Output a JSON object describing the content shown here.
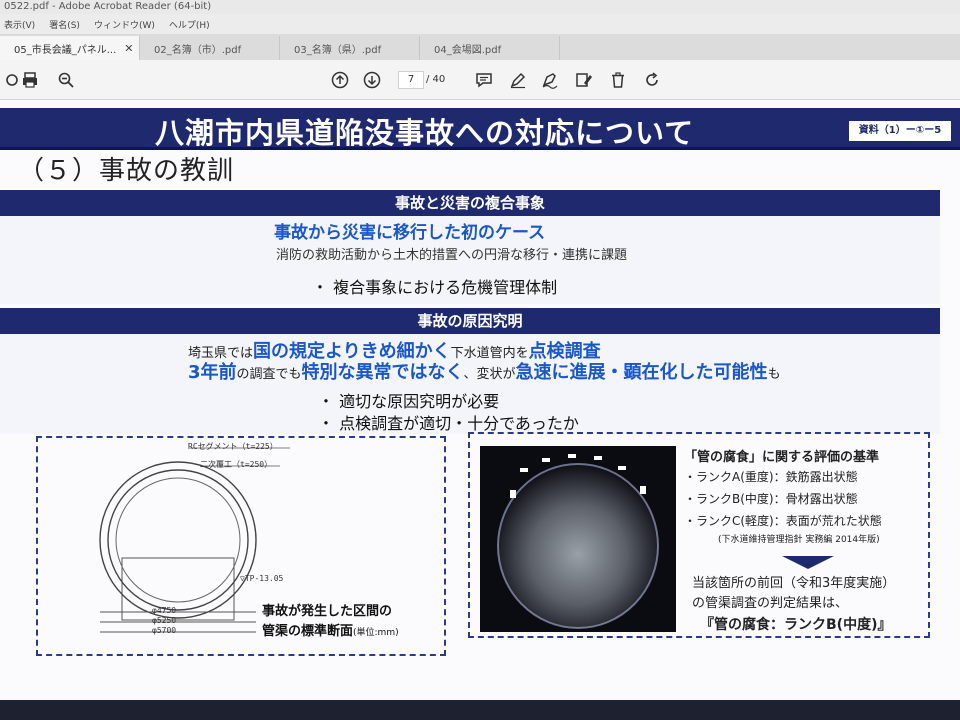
{
  "window": {
    "title": "0522.pdf - Adobe Acrobat Reader (64-bit)"
  },
  "menu": [
    "表示(V)",
    "署名(S)",
    "ウィンドウ(W)",
    "ヘルプ(H)"
  ],
  "tabs": [
    {
      "label": "05_市長会議_パネル...",
      "active": true
    },
    {
      "label": "02_名簿（市）.pdf",
      "active": false
    },
    {
      "label": "03_名簿（県）.pdf",
      "active": false
    },
    {
      "label": "04_会場図.pdf",
      "active": false
    }
  ],
  "toolbar": {
    "page_current": "7",
    "page_total": "/ 40"
  },
  "slide": {
    "title": "八潮市内県道陥没事故への対応について",
    "ref": "資料（1）ー①ー5",
    "section": "（５）事故の教訓",
    "block1": {
      "header": "事故と災害の複合事象",
      "line_a": "事故から災害に移行した初のケース",
      "line_b": "消防の救助活動から土木的措置への円滑な移行・連携に課題",
      "bullet": "・ 複合事象における危機管理体制"
    },
    "block2": {
      "header": "事故の原因究明",
      "line1_pre": "埼玉県では",
      "line1_b1": "国の規定よりきめ細かく",
      "line1_mid": "下水道管内を",
      "line1_b2": "点検調査",
      "line2_b1": "3年前",
      "line2_mid": "の調査でも",
      "line2_b2": "特別な異常ではなく",
      "line2_mid2": "、変状が",
      "line2_b3": "急速に進展・顕在化した可能性",
      "line2_post": "も",
      "bullet1": "・ 適切な原因究明が必要",
      "bullet2": "・ 点検調査が適切・十分であったか"
    },
    "diagram": {
      "lbl1": "RCセグメント（t=225）",
      "lbl2": "二次覆工（t=250）",
      "lbl3": "▽TP-13.05",
      "dim1": "φ4750",
      "dim2": "φ5250",
      "dim3": "φ5700",
      "caption1": "事故が発生した区間の",
      "caption2": "管渠の標準断面",
      "caption_unit": "(単位:mm)"
    },
    "criteria": {
      "title": "「管の腐食」に関する評価の基準",
      "a": "・ランクA(重度)：鉄筋露出状態",
      "b": "・ランクB(中度)：骨材露出状態",
      "c": "・ランクC(軽度)：表面が荒れた状態",
      "source": "(下水道維持管理指針 実務編 2014年版)",
      "result1": "当該箇所の前回（令和3年度実施）",
      "result2": "の管渠調査の判定結果は、",
      "result3": "『管の腐食：ランクB(中度)』"
    }
  },
  "colors": {
    "navy": "#1f2a6e",
    "accent_blue": "#1a57c7"
  }
}
